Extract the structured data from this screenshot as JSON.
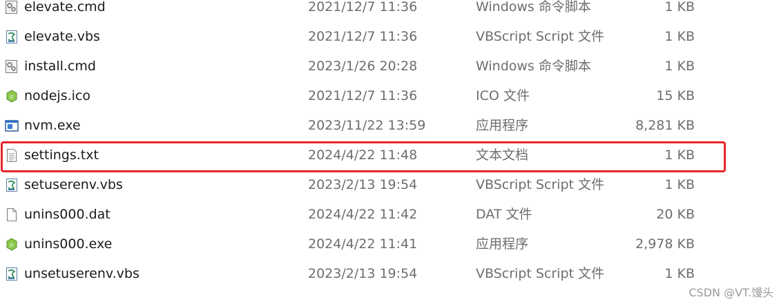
{
  "files": [
    {
      "name": "elevate.cmd",
      "date": "2021/12/7 11:36",
      "type": "Windows 命令脚本",
      "size": "1 KB",
      "icon": "cmd-script-icon"
    },
    {
      "name": "elevate.vbs",
      "date": "2021/12/7 11:36",
      "type": "VBScript Script 文件",
      "size": "1 KB",
      "icon": "vbscript-file-icon"
    },
    {
      "name": "install.cmd",
      "date": "2023/1/26 20:28",
      "type": "Windows 命令脚本",
      "size": "1 KB",
      "icon": "cmd-script-icon"
    },
    {
      "name": "nodejs.ico",
      "date": "2021/12/7 11:36",
      "type": "ICO 文件",
      "size": "15 KB",
      "icon": "nodejs-icon"
    },
    {
      "name": "nvm.exe",
      "date": "2023/11/22 13:59",
      "type": "应用程序",
      "size": "8,281 KB",
      "icon": "application-window-icon"
    },
    {
      "name": "settings.txt",
      "date": "2024/4/22 11:48",
      "type": "文本文档",
      "size": "1 KB",
      "icon": "text-document-icon"
    },
    {
      "name": "setuserenv.vbs",
      "date": "2023/2/13 19:54",
      "type": "VBScript Script 文件",
      "size": "1 KB",
      "icon": "vbscript-file-icon"
    },
    {
      "name": "unins000.dat",
      "date": "2024/4/22 11:42",
      "type": "DAT 文件",
      "size": "20 KB",
      "icon": "blank-file-icon"
    },
    {
      "name": "unins000.exe",
      "date": "2024/4/22 11:41",
      "type": "应用程序",
      "size": "2,978 KB",
      "icon": "nodejs-icon"
    },
    {
      "name": "unsetuserenv.vbs",
      "date": "2023/2/13 19:54",
      "type": "VBScript Script 文件",
      "size": "1 KB",
      "icon": "vbscript-file-icon"
    }
  ],
  "highlight": {
    "row_name": "settings.txt",
    "color": "#e8262a"
  },
  "watermark": "CSDN @VT.馒头"
}
